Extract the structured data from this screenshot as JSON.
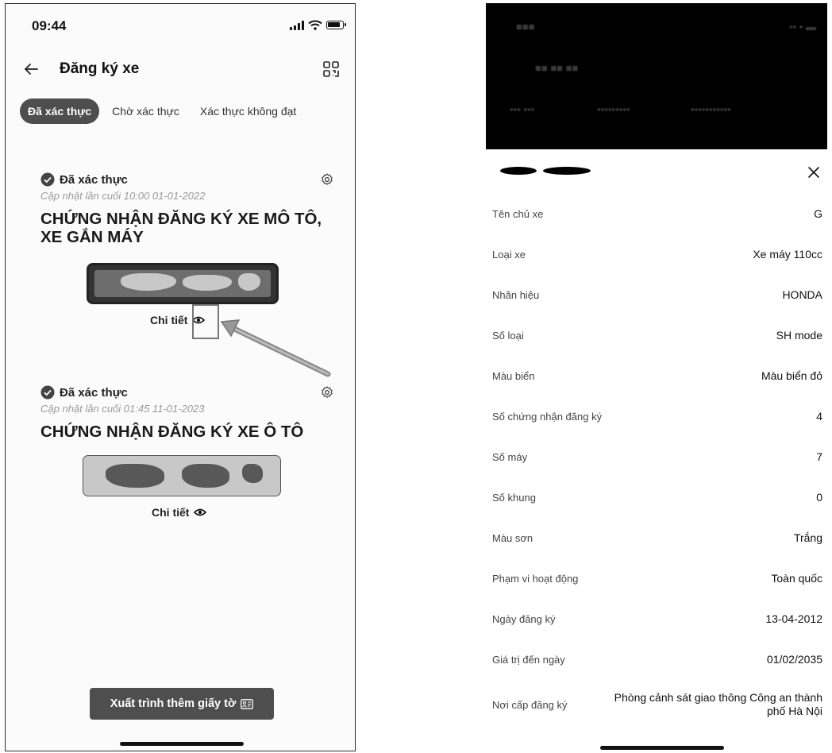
{
  "left_screen": {
    "status_bar": {
      "time": "09:44"
    },
    "header": {
      "title": "Đăng ký xe",
      "back_icon": "arrow-left-icon",
      "action_icon": "qr-scan-icon"
    },
    "tabs": [
      {
        "label": "Đã xác thực",
        "active": true
      },
      {
        "label": "Chờ xác thực",
        "active": false
      },
      {
        "label": "Xác thực không đạt",
        "active": false
      }
    ],
    "cards": [
      {
        "status": "Đã xác thực",
        "updated": "Cập nhật lần cuối 10:00 01-01-2022",
        "title": "CHỨNG NHẬN ĐĂNG KÝ XE MÔ TÔ, XE GẮN MÁY",
        "detail_label": "Chi tiết"
      },
      {
        "status": "Đã xác thực",
        "updated": "Cập nhật lần cuối 01:45 11-01-2023",
        "title": "CHỨNG NHẬN ĐĂNG KÝ XE Ô TÔ",
        "detail_label": "Chi tiết"
      }
    ],
    "export_button": {
      "label": "Xuất trình thêm giấy tờ",
      "icon": "id-card-icon"
    }
  },
  "right_screen": {
    "close_icon": "close-icon",
    "fields": [
      {
        "label": "Tên chủ xe",
        "value": "G"
      },
      {
        "label": "Loại xe",
        "value": "Xe máy 110cc"
      },
      {
        "label": "Nhãn hiệu",
        "value": "HONDA"
      },
      {
        "label": "Số loại",
        "value": "SH mode"
      },
      {
        "label": "Màu biển",
        "value": "Màu biển đỏ"
      },
      {
        "label": "Số chứng nhận đăng ký",
        "value": "4"
      },
      {
        "label": "Số máy",
        "value": "7"
      },
      {
        "label": "Số khung",
        "value": "0"
      },
      {
        "label": "Màu sơn",
        "value": "Trắng"
      },
      {
        "label": "Phạm vi hoạt động",
        "value": "Toàn quốc"
      },
      {
        "label": "Ngày đăng ký",
        "value": "13-04-2012"
      },
      {
        "label": "Giá trị đến ngày",
        "value": "01/02/2035"
      },
      {
        "label": "Nơi cấp đăng ký",
        "value": "Phòng cảnh sát giao thông Công an thành phố Hà Nội"
      }
    ]
  },
  "colors": {
    "accent": "#4e4e4e",
    "muted_text": "#9a9a9a",
    "overlay": "#000000"
  }
}
